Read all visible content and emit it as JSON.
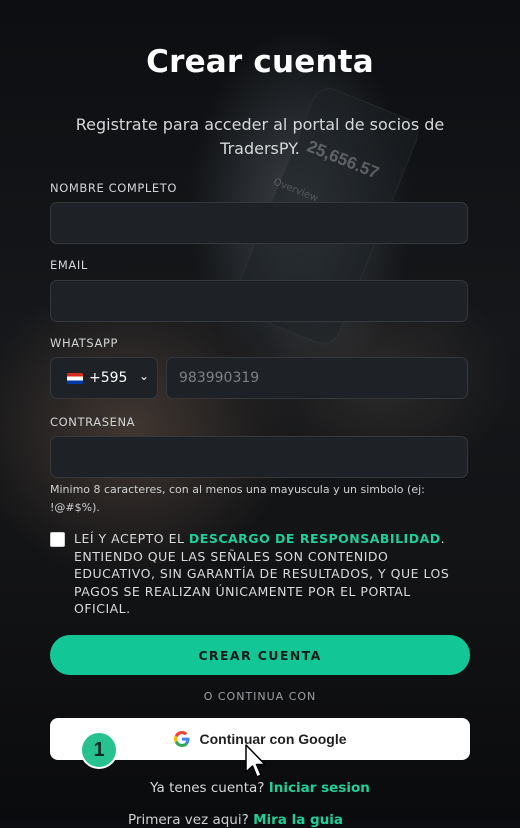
{
  "page": {
    "title": "Crear cuenta",
    "subtitle": "Registrate para acceder al portal de socios de TradersPY."
  },
  "background": {
    "phone_figure": "25,656.57",
    "phone_label": "Overview"
  },
  "form": {
    "name_label": "NOMBRE COMPLETO",
    "name_value": "",
    "email_label": "EMAIL",
    "email_value": "",
    "whatsapp_label": "WHATSAPP",
    "country_code": "+595",
    "country_flag_icon": "paraguay-flag-icon",
    "phone_placeholder": "983990319",
    "password_label": "CONTRASENA",
    "password_value": "",
    "password_hint": "Minimo 8 caracteres, con al menos una mayuscula y un simbolo (ej: !@#$%).",
    "terms_prefix": "LEÍ Y ACEPTO EL ",
    "terms_link": "DESCARGO DE RESPONSABILIDAD",
    "terms_suffix": ". ENTIENDO QUE LAS SEÑALES SON CONTENIDO EDUCATIVO, SIN GARANTÍA DE RESULTADOS, Y QUE LOS PAGOS SE REALIZAN ÚNICAMENTE POR EL PORTAL OFICIAL.",
    "terms_checked": false,
    "submit_label": "CREAR CUENTA",
    "divider_label": "O CONTINUA CON",
    "google_label": "Continuar con Google"
  },
  "footer": {
    "login_prompt": "Ya tenes cuenta? ",
    "login_link": "Iniciar sesion",
    "cut_prefix": "Primera vez aqui? ",
    "cut_link": "Mira la guia"
  },
  "overlay": {
    "step_number": "1"
  },
  "colors": {
    "accent": "#12c795",
    "link": "#1fcf9a",
    "field_bg": "#1e2125",
    "page_bg": "#0b0d10"
  }
}
